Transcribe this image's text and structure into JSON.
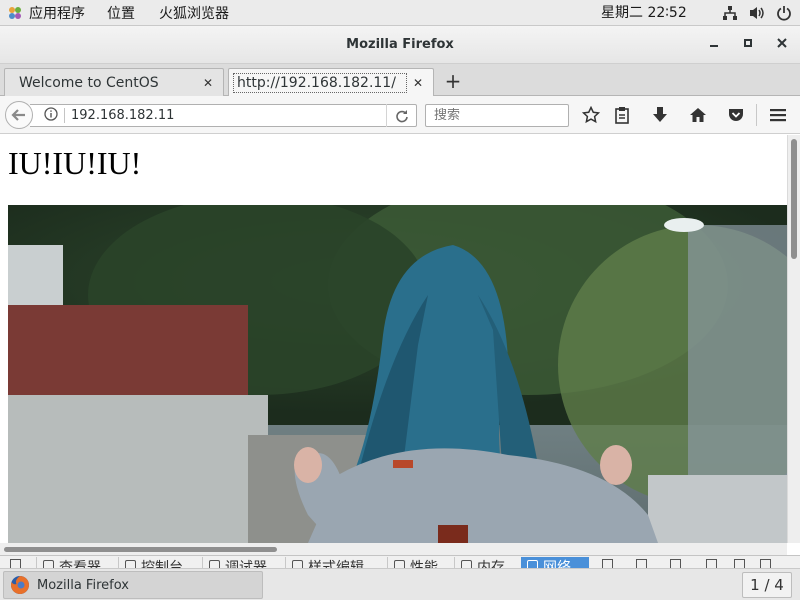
{
  "topbar": {
    "applications": "应用程序",
    "places": "位置",
    "active_app": "火狐浏览器",
    "clock": "星期二 22∶52"
  },
  "window": {
    "title": "Mozilla Firefox"
  },
  "tabs": [
    {
      "label": "Welcome to CentOS",
      "active": false
    },
    {
      "label": "http://192.168.182.11/",
      "active": true
    }
  ],
  "navbar": {
    "url": "192.168.182.11",
    "search_placeholder": "搜索"
  },
  "page": {
    "heading": "IU!IU!IU!"
  },
  "devtools": {
    "tabs": [
      "查看器",
      "控制台",
      "调试器",
      "样式编辑",
      "性能",
      "内存",
      "网络"
    ],
    "active_tab": "网络"
  },
  "taskbar": {
    "item_label": "Mozilla Firefox",
    "workspace": "1 / 4"
  },
  "colors": {
    "devtools_active": "#4a90d9",
    "hair": "#2a6f8c"
  }
}
